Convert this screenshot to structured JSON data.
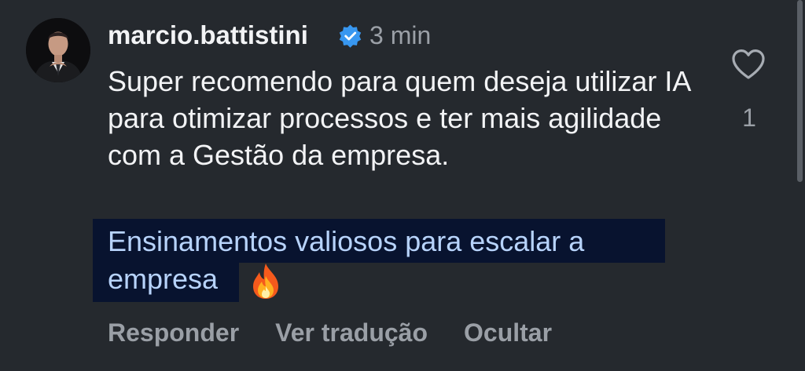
{
  "comment": {
    "username": "marcio.battistini",
    "verified": true,
    "timestamp": "3 min",
    "text": "Super recomendo para quem deseja utilizar IA para otimizar processos e ter mais agilidade com a Gestão da empresa.",
    "translation": "Ensinamentos valiosos para escalar a empresa",
    "emoji": "fire-emoji",
    "likes": "1",
    "actions": {
      "reply": "Responder",
      "translate": "Ver tradução",
      "hide": "Ocultar"
    }
  },
  "icons": {
    "verified": "verified-badge-icon",
    "like": "heart-outline-icon"
  },
  "colors": {
    "background": "#25292e",
    "text": "#f2f3f5",
    "muted": "#9ba0a7",
    "verified": "#3897f0",
    "translation_text": "#b7d3fb",
    "translation_highlight": "#08132f"
  }
}
